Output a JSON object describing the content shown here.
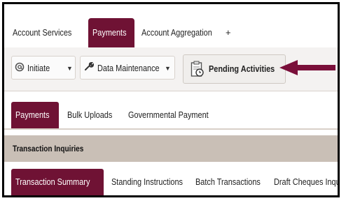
{
  "top_tabs": {
    "account_services": "Account Services",
    "payments": "Payments",
    "account_aggregation": "Account Aggregation",
    "add": "+"
  },
  "toolbar": {
    "initiate": "Initiate",
    "data_maintenance": "Data Maintenance",
    "pending_activities": "Pending Activities",
    "caret": "▼"
  },
  "sub_tabs": {
    "payments": "Payments",
    "bulk_uploads": "Bulk Uploads",
    "governmental_payment": "Governmental Payment"
  },
  "section_header": "Transaction Inquiries",
  "inquiry_tabs": {
    "transaction_summary": "Transaction Summary",
    "standing_instructions": "Standing Instructions",
    "batch_transactions": "Batch Transactions",
    "draft_cheques": "Draft Cheques Inqui"
  },
  "icons": {
    "initiate": "at-sign-icon",
    "data_maintenance": "wrench-icon",
    "pending": "clipboard-clock-icon",
    "annotation": "arrow-left-icon"
  },
  "colors": {
    "accent": "#6f1234",
    "arrow": "#7a0f3a",
    "section_header_bg": "#c9bfb6",
    "toolbar_bg": "#f4f2f1"
  }
}
